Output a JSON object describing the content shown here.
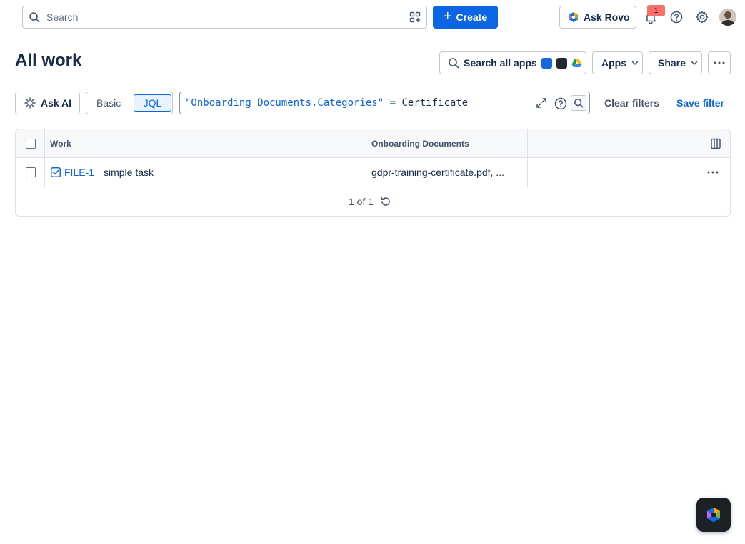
{
  "topbar": {
    "search_placeholder": "Search",
    "create_label": "Create",
    "ask_rovo_label": "Ask Rovo",
    "notification_count": "1"
  },
  "page": {
    "title": "All work",
    "search_apps_label": "Search all apps",
    "apps_label": "Apps",
    "share_label": "Share"
  },
  "filters": {
    "ask_ai_label": "Ask AI",
    "basic_label": "Basic",
    "jql_label": "JQL",
    "jql_field": "\"Onboarding Documents.Categories\"",
    "jql_operator": "=",
    "jql_value": "Certificate",
    "clear_filters_label": "Clear filters",
    "save_filter_label": "Save filter"
  },
  "table": {
    "columns": [
      "Work",
      "Onboarding Documents"
    ],
    "rows": [
      {
        "key": "FILE-1",
        "summary": "simple task",
        "onboarding_documents": "gdpr-training-certificate.pdf, ..."
      }
    ],
    "pagination": "1 of 1"
  },
  "colors": {
    "accent": "#0c66e4",
    "badge": "#f87168",
    "text": "#172b4d"
  }
}
